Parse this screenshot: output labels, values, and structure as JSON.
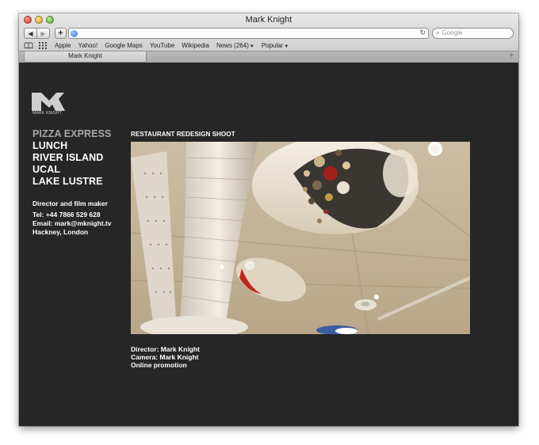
{
  "window": {
    "title": "Mark Knight"
  },
  "toolbar": {
    "back": "◀",
    "forward": "▶",
    "add": "+",
    "url": "",
    "reload": "↻",
    "search_placeholder": "Google"
  },
  "bookmarks": {
    "items": [
      {
        "label": "Apple",
        "dropdown": false
      },
      {
        "label": "Yahoo!",
        "dropdown": false
      },
      {
        "label": "Google Maps",
        "dropdown": false
      },
      {
        "label": "YouTube",
        "dropdown": false
      },
      {
        "label": "Wikipedia",
        "dropdown": false
      },
      {
        "label": "News (264)",
        "dropdown": true
      },
      {
        "label": "Popular",
        "dropdown": true
      }
    ]
  },
  "tabs": {
    "active": "Mark Knight",
    "new_tab": "+"
  },
  "site": {
    "logo_text": "MARK KNIGHT",
    "nav": [
      {
        "label": "PIZZA EXPRESS",
        "active": true
      },
      {
        "label": "LUNCH",
        "active": false
      },
      {
        "label": "RIVER ISLAND",
        "active": false
      },
      {
        "label": "UCAL",
        "active": false
      },
      {
        "label": "LAKE LUSTRE",
        "active": false
      }
    ],
    "info": {
      "role": "Director and film maker",
      "tel": "Tel: +44 7866 529 628",
      "email": "Email: mark@mknight.tv",
      "location": "Hackney, London"
    },
    "project": {
      "title": "RESTAURANT REDESIGN SHOOT",
      "credits": [
        "Director: Mark Knight",
        "Camera: Mark Knight",
        "Online promotion"
      ]
    }
  },
  "colors": {
    "page_bg": "#262626",
    "text": "#ffffff",
    "nav_active": "#a8a8a8"
  }
}
